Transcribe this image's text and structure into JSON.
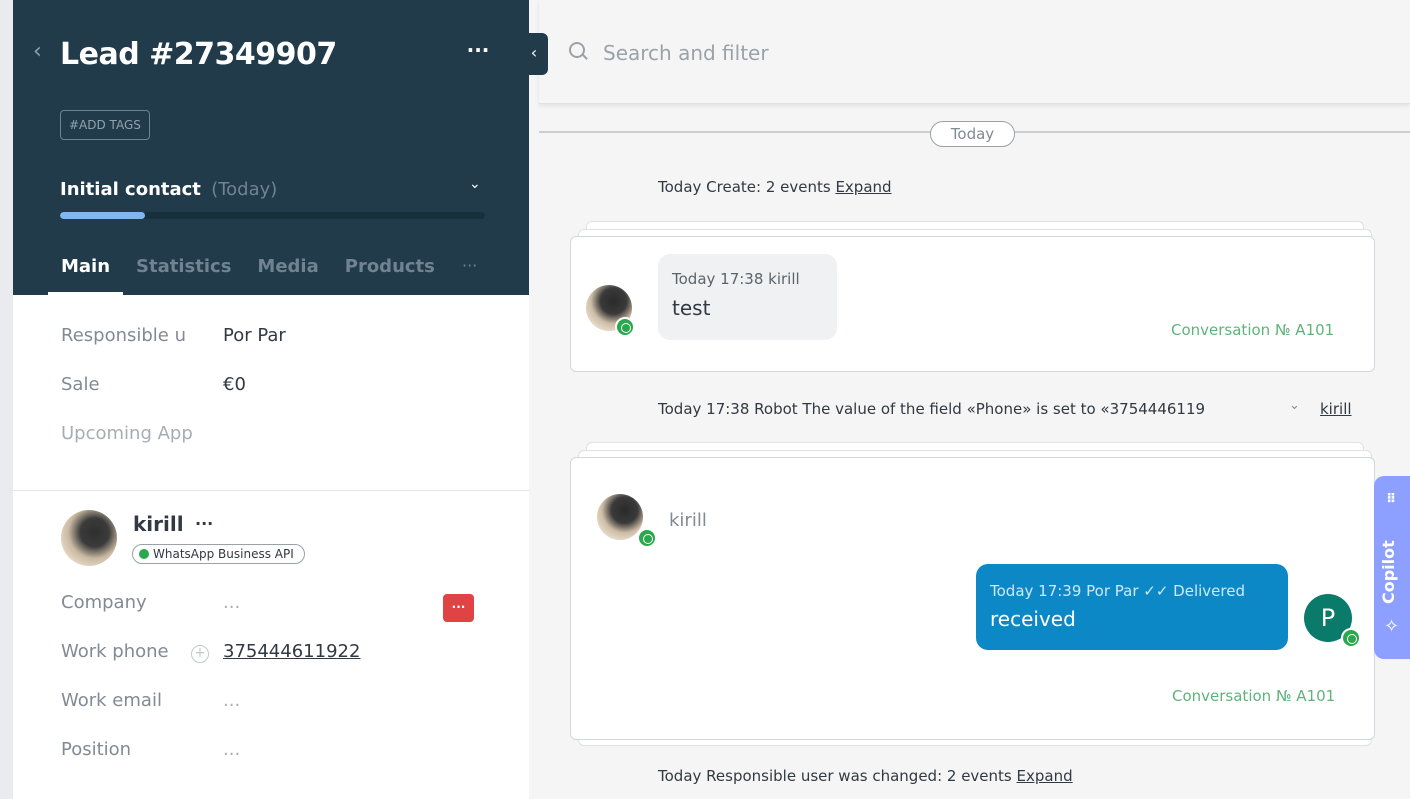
{
  "lead": {
    "title": "Lead #27349907",
    "add_tags": "#ADD TAGS",
    "stage": {
      "name": "Initial contact",
      "date": "(Today)",
      "progress": 0.2
    },
    "tabs": [
      "Main",
      "Statistics",
      "Media",
      "Products"
    ],
    "fields": [
      {
        "label": "Responsible u",
        "value": "Por Par"
      },
      {
        "label": "Sale",
        "value": "€0"
      },
      {
        "label": "Upcoming App",
        "value": ""
      }
    ]
  },
  "contact": {
    "name": "kirill",
    "channel_badge": "WhatsApp Business API",
    "fields": [
      {
        "label": "Company",
        "value": "..."
      },
      {
        "label": "Work phone",
        "value": "375444611922"
      },
      {
        "label": "Work email",
        "value": "..."
      },
      {
        "label": "Position",
        "value": "..."
      }
    ],
    "company_action": "···"
  },
  "search": {
    "placeholder": "Search and filter"
  },
  "feed": {
    "date_divider": "Today",
    "event_create": {
      "text": "Today Create: 2 events",
      "link": "Expand"
    },
    "message_in": {
      "meta": "Today 17:38 kirill",
      "text": "test",
      "conversation": "Conversation № A101"
    },
    "robot_event": {
      "text": "Today 17:38 Robot The value of the field «Phone» is set to «3754446119",
      "user": "kirill"
    },
    "thread": {
      "sender": "kirill",
      "message_out": {
        "meta": "Today 17:39 Por Par ✓✓ Delivered",
        "text": "received",
        "avatar_letter": "P"
      },
      "conversation": "Conversation № A101"
    },
    "event_responsible": {
      "text": "Today Responsible user was changed: 2 events",
      "link": "Expand"
    }
  },
  "copilot": {
    "label": "Copilot"
  },
  "colors": {
    "header_bg": "#213b4b",
    "accent_blue": "#0d88c7",
    "whatsapp_green": "#2aa84e",
    "copilot": "#8ea0ff",
    "link_green": "#5fb37a",
    "danger": "#e04343"
  }
}
